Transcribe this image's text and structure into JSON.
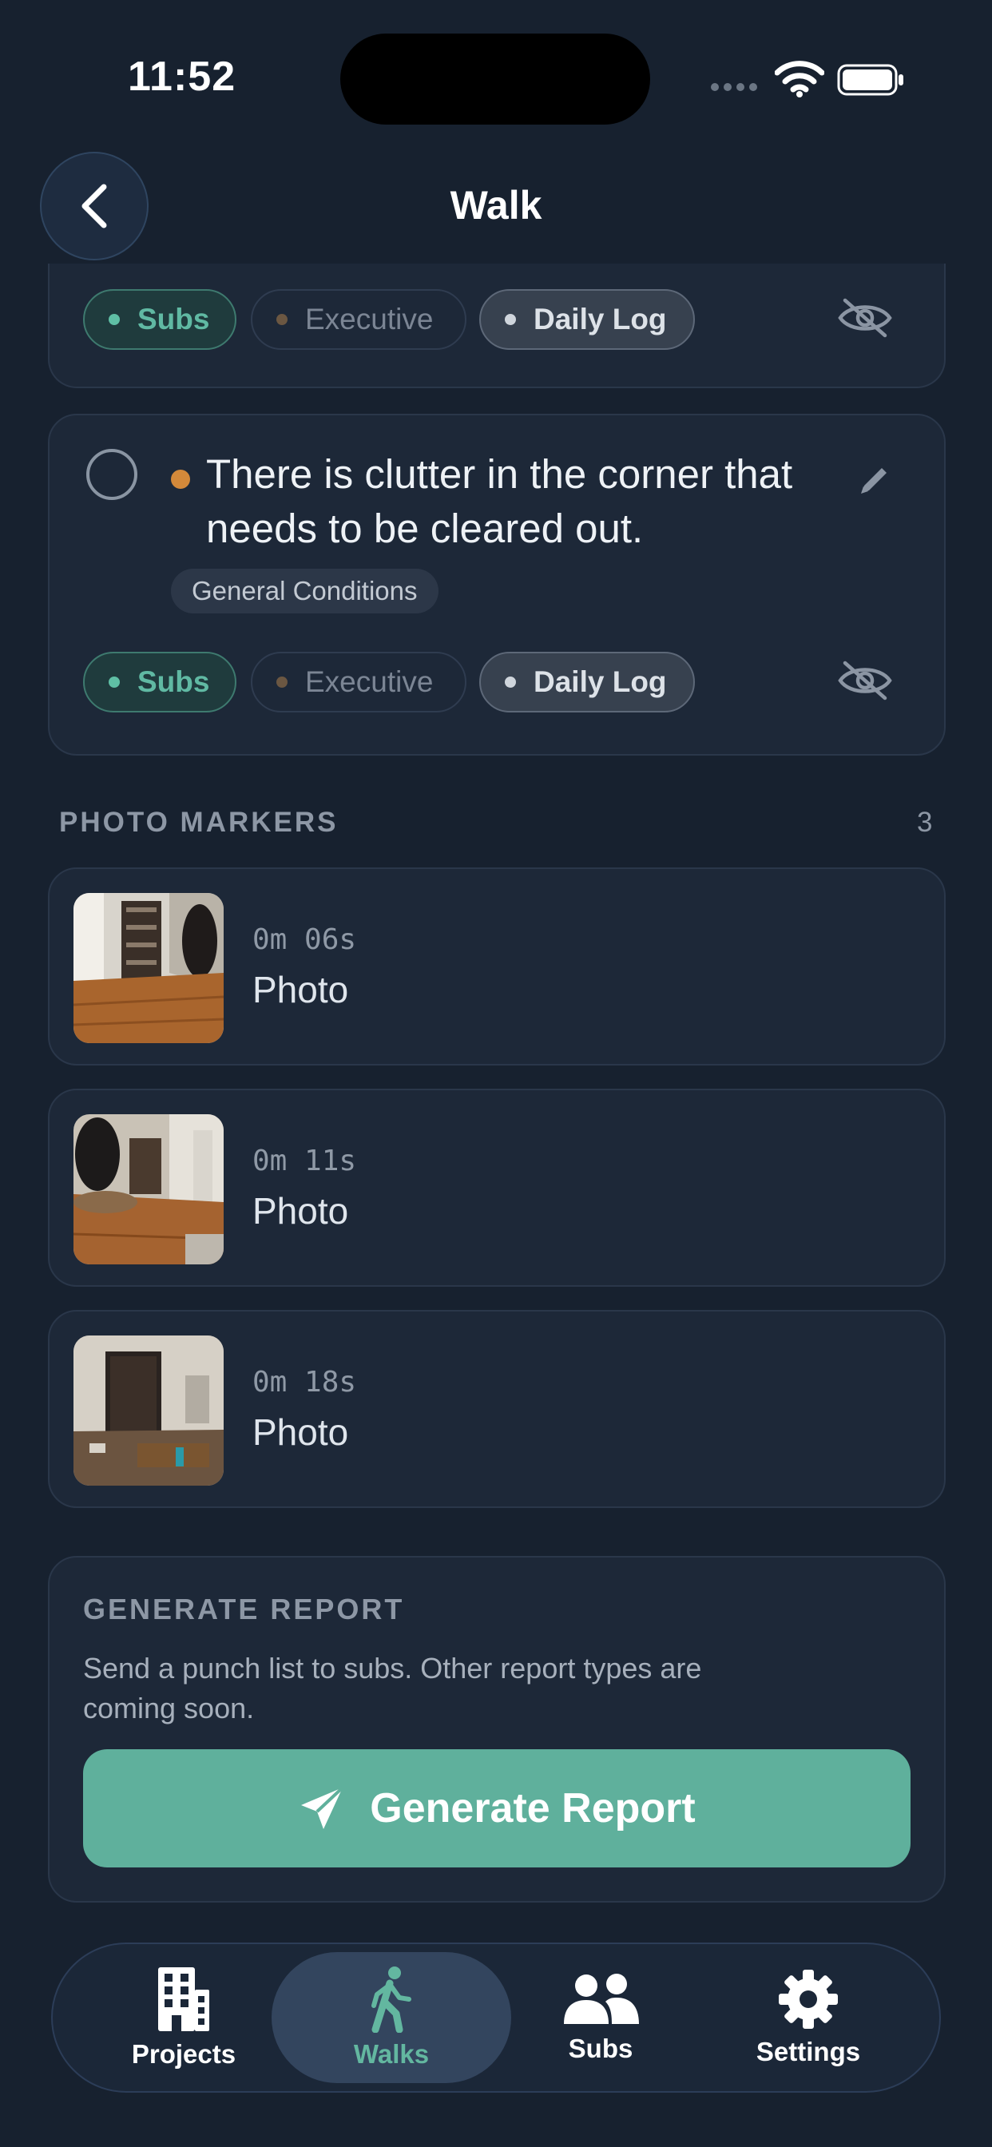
{
  "status_bar": {
    "time": "11:52"
  },
  "header": {
    "title": "Walk"
  },
  "previous_item": {
    "chips": {
      "subs": "Subs",
      "executive": "Executive",
      "daily_log": "Daily Log"
    }
  },
  "item": {
    "text": "There is clutter in the corner that needs to be cleared out.",
    "category": "General Conditions",
    "chips": {
      "subs": "Subs",
      "executive": "Executive",
      "daily_log": "Daily Log"
    }
  },
  "photo_markers": {
    "label": "PHOTO MARKERS",
    "count": "3",
    "items": [
      {
        "time": "0m 06s",
        "label": "Photo"
      },
      {
        "time": "0m 11s",
        "label": "Photo"
      },
      {
        "time": "0m 18s",
        "label": "Photo"
      }
    ]
  },
  "report": {
    "title": "GENERATE REPORT",
    "description": "Send a punch list to subs. Other report types are coming soon.",
    "button_label": "Generate Report"
  },
  "tabbar": {
    "projects": "Projects",
    "walks": "Walks",
    "subs": "Subs",
    "settings": "Settings",
    "active": "walks"
  },
  "colors": {
    "background": "#17212f",
    "card": "#1d2838",
    "accent": "#5fb09c",
    "item_dot": "#d3893a"
  }
}
